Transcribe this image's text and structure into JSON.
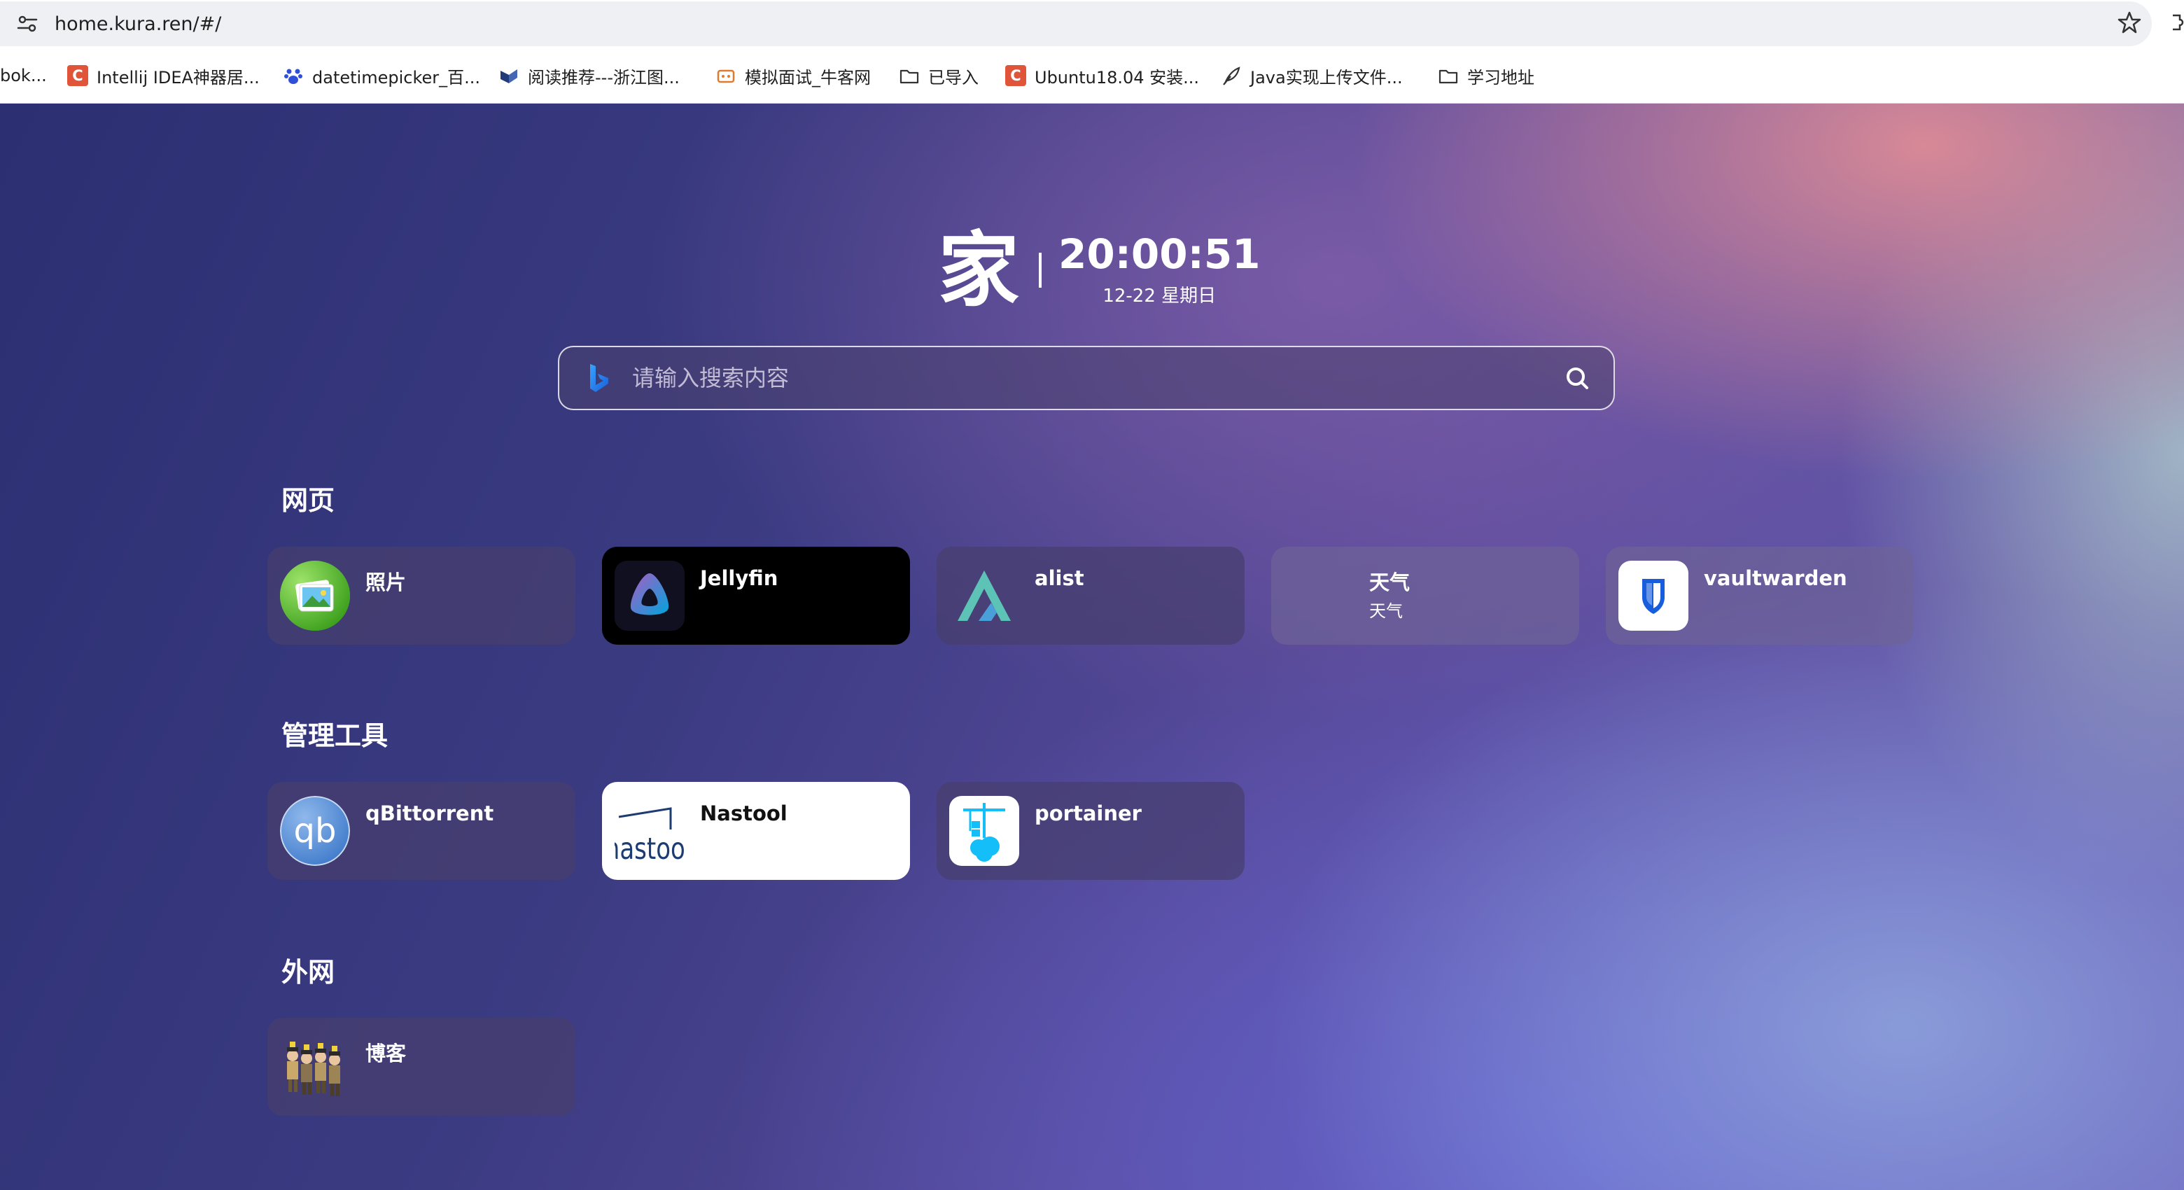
{
  "browser": {
    "url": "home.kura.ren/#/",
    "bookmarks": [
      {
        "label": "bok...",
        "icon": "none"
      },
      {
        "label": "Intellij IDEA神器居...",
        "icon": "csdn-icon"
      },
      {
        "label": "datetimepicker_百...",
        "icon": "baidu-paw-icon"
      },
      {
        "label": "阅读推荐---浙江图...",
        "icon": "library-icon"
      },
      {
        "label": "模拟面试_牛客网",
        "icon": "nowcoder-icon"
      },
      {
        "label": "已导入",
        "icon": "folder-icon"
      },
      {
        "label": "Ubuntu18.04 安装...",
        "icon": "csdn-icon"
      },
      {
        "label": "Java实现上传文件...",
        "icon": "feather-icon"
      },
      {
        "label": "学习地址",
        "icon": "folder-icon"
      }
    ]
  },
  "header": {
    "logo": "家",
    "time": "20:00:51",
    "date": "12-22 星期日"
  },
  "search": {
    "placeholder": "请输入搜索内容",
    "engine_icon": "bing-icon"
  },
  "sections": [
    {
      "title": "网页",
      "items": [
        {
          "title": "照片",
          "subtitle": "",
          "icon": "photos-icon"
        },
        {
          "title": "Jellyfin",
          "subtitle": "",
          "icon": "jellyfin-icon"
        },
        {
          "title": "alist",
          "subtitle": "",
          "icon": "alist-icon"
        },
        {
          "title": "天气",
          "subtitle": "天气",
          "icon": "none"
        },
        {
          "title": "vaultwarden",
          "subtitle": "",
          "icon": "vaultwarden-icon"
        }
      ]
    },
    {
      "title": "管理工具",
      "items": [
        {
          "title": "qBittorrent",
          "subtitle": "",
          "icon": "qbittorrent-icon"
        },
        {
          "title": "Nastool",
          "subtitle": "",
          "icon": "nastool-icon"
        },
        {
          "title": "portainer",
          "subtitle": "",
          "icon": "portainer-icon"
        }
      ]
    },
    {
      "title": "外网",
      "items": [
        {
          "title": "博客",
          "subtitle": "",
          "icon": "blog-avatar-icon"
        }
      ]
    }
  ],
  "icon_texts": {
    "qbittorrent": "qb",
    "nastool": "nastool",
    "csdn": "C"
  },
  "colors": {
    "accent_green": "#56c22e",
    "jellyfin_purple": "#aa5cc3",
    "jellyfin_blue": "#00a4dc",
    "alist_teal": "#5ec3b7",
    "vaultwarden_blue": "#175ddc",
    "qbittorrent_blue": "#3d79c9",
    "portainer_blue": "#13bef9",
    "csdn_red": "#e0553a"
  }
}
